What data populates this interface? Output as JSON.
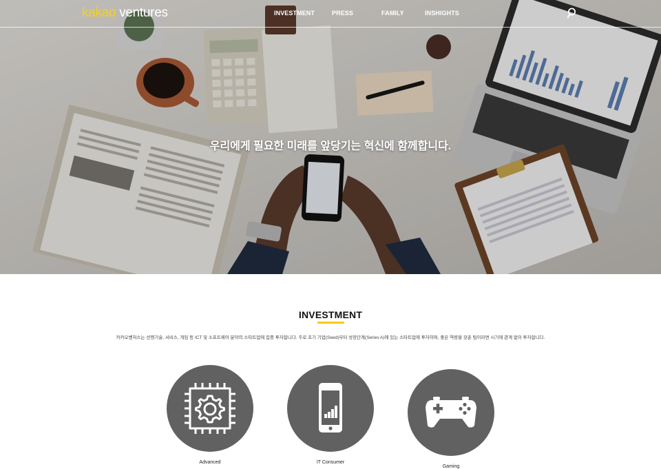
{
  "header": {
    "logo_part1": "kakao",
    "logo_part2": "ventures",
    "nav": [
      "INVESTMENT",
      "PRESS",
      "FAMILY",
      "INSHIGHTS"
    ],
    "search_icon": "search-icon"
  },
  "hero": {
    "slogan": "우리에게 필요한 미래를 앞당기는 혁신에 함께합니다."
  },
  "investment": {
    "title": "INVESTMENT",
    "description": "카카오벤처스는 선행기술, 서비스, 게임 등 ICT 및 소프트웨어 분야의 스타트업에 집중 투자합니다. 주로 초기 기업(Seed)부터 성장단계(Series A)에 있는 스타트업에 투자하며, 좋은 역량을 갖춘 팀이라면 시기에 관계 없이 투자합니다.",
    "categories": [
      {
        "label": "Advanced",
        "icon": "chip-gear-icon"
      },
      {
        "label": "IT Consumer",
        "icon": "smartphone-icon"
      },
      {
        "label": "Gaming",
        "icon": "gamepad-icon"
      }
    ]
  },
  "colors": {
    "accent": "#f5d21c",
    "circle": "#616161",
    "title_underline": "#f5cc0f"
  }
}
